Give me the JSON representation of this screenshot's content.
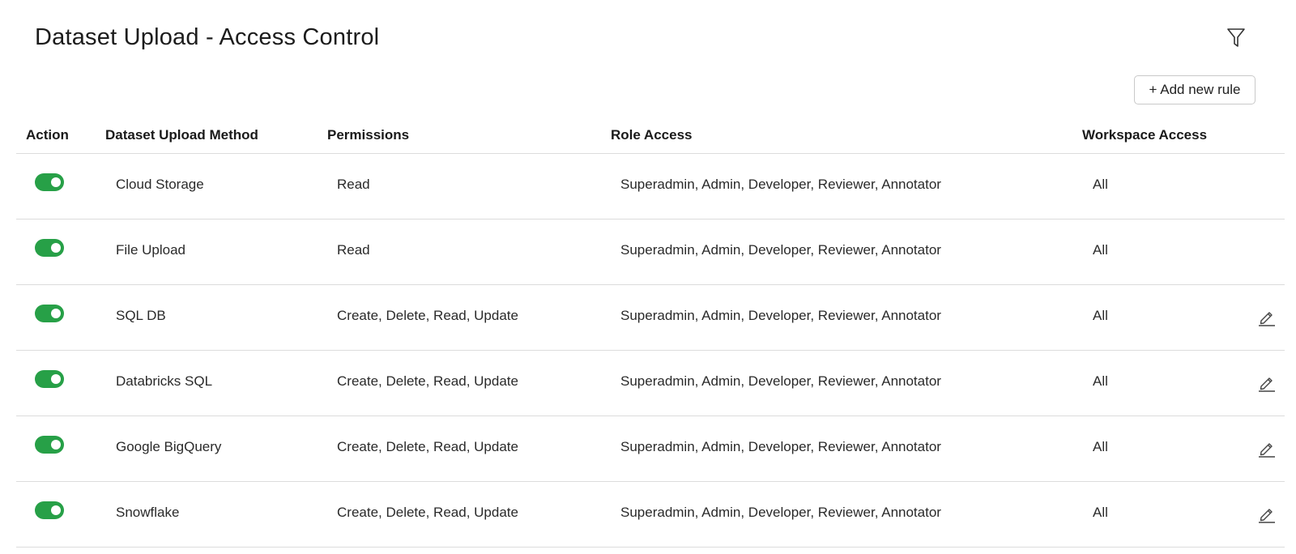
{
  "page": {
    "title": "Dataset Upload - Access Control"
  },
  "toolbar": {
    "filter_icon": "filter-icon",
    "add_rule_label": "+ Add new rule"
  },
  "table": {
    "headers": {
      "action": "Action",
      "method": "Dataset Upload Method",
      "permissions": "Permissions",
      "role_access": "Role Access",
      "workspace_access": "Workspace Access"
    },
    "rows": [
      {
        "enabled": true,
        "method": "Cloud Storage",
        "permissions": "Read",
        "role_access": "Superadmin, Admin, Developer, Reviewer, Annotator",
        "workspace_access": "All",
        "editable": false
      },
      {
        "enabled": true,
        "method": "File Upload",
        "permissions": "Read",
        "role_access": "Superadmin, Admin, Developer, Reviewer, Annotator",
        "workspace_access": "All",
        "editable": false
      },
      {
        "enabled": true,
        "method": "SQL DB",
        "permissions": "Create, Delete, Read, Update",
        "role_access": "Superadmin, Admin, Developer, Reviewer, Annotator",
        "workspace_access": "All",
        "editable": true
      },
      {
        "enabled": true,
        "method": "Databricks SQL",
        "permissions": "Create, Delete, Read, Update",
        "role_access": "Superadmin, Admin, Developer, Reviewer, Annotator",
        "workspace_access": "All",
        "editable": true
      },
      {
        "enabled": true,
        "method": "Google BigQuery",
        "permissions": "Create, Delete, Read, Update",
        "role_access": "Superadmin, Admin, Developer, Reviewer, Annotator",
        "workspace_access": "All",
        "editable": true
      },
      {
        "enabled": true,
        "method": "Snowflake",
        "permissions": "Create, Delete, Read, Update",
        "role_access": "Superadmin, Admin, Developer, Reviewer, Annotator",
        "workspace_access": "All",
        "editable": true
      }
    ]
  },
  "colors": {
    "toggle_on": "#27a047",
    "border": "#dcdcdc",
    "text": "#2a2a2a"
  },
  "icons": {
    "edit": "pencil-icon",
    "filter": "filter-icon"
  }
}
